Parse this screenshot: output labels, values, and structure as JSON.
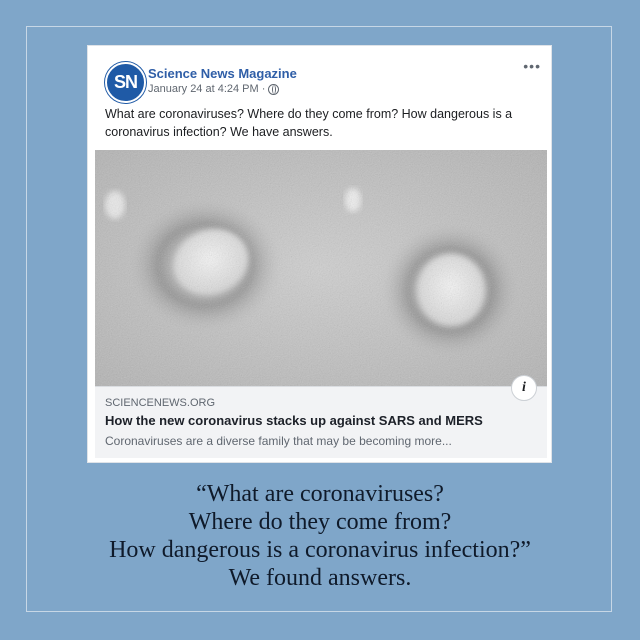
{
  "post": {
    "avatar_text": "SN",
    "page_name": "Science News Magazine",
    "timestamp": "January 24 at 4:24 PM ·",
    "privacy_icon": "globe-icon",
    "more_icon": "more-options-icon",
    "text": "What are coronaviruses? Where do they come from? How dangerous is a coronavirus infection? We have answers."
  },
  "link_preview": {
    "domain": "SCIENCENEWS.ORG",
    "title": "How the new coronavirus stacks up against SARS and MERS",
    "description": "Coronaviruses are a diverse family that may be becoming more...",
    "info_icon": "info-icon"
  },
  "caption": {
    "lines": [
      "“What are coronaviruses?",
      "Where do they come from?",
      "How dangerous is a coronavirus infection?”",
      "We found answers."
    ]
  },
  "colors": {
    "background": "#7fa6c9",
    "brand_blue": "#1f5aa6",
    "page_name": "#2f5ea7"
  }
}
